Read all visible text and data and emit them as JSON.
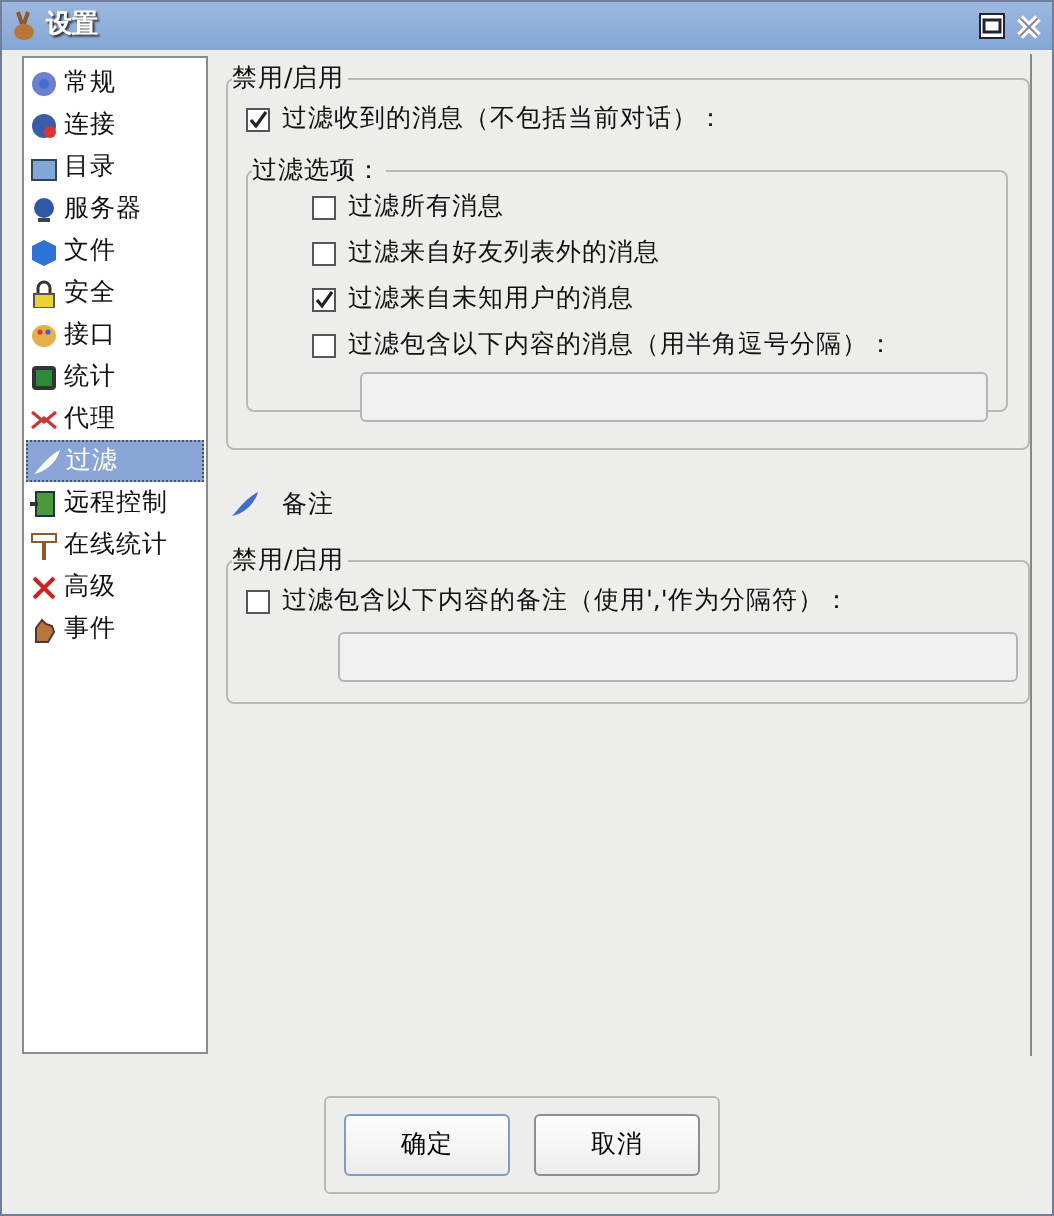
{
  "window": {
    "title": "设置"
  },
  "sidebar": {
    "items": [
      {
        "label": "常规",
        "selected": false
      },
      {
        "label": "连接",
        "selected": false
      },
      {
        "label": "目录",
        "selected": false
      },
      {
        "label": "服务器",
        "selected": false
      },
      {
        "label": "文件",
        "selected": false
      },
      {
        "label": "安全",
        "selected": false
      },
      {
        "label": "接口",
        "selected": false
      },
      {
        "label": "统计",
        "selected": false
      },
      {
        "label": "代理",
        "selected": false
      },
      {
        "label": "过滤",
        "selected": true
      },
      {
        "label": "远程控制",
        "selected": false
      },
      {
        "label": "在线统计",
        "selected": false
      },
      {
        "label": "高级",
        "selected": false
      },
      {
        "label": "事件",
        "selected": false
      }
    ]
  },
  "messages": {
    "group_title": "禁用/启用",
    "enable": {
      "label": "过滤收到的消息（不包括当前对话）：",
      "checked": true
    },
    "options_title": "过滤选项：",
    "options": [
      {
        "label": "过滤所有消息",
        "checked": false
      },
      {
        "label": "过滤来自好友列表外的消息",
        "checked": false
      },
      {
        "label": "过滤来自未知用户的消息",
        "checked": true
      },
      {
        "label": "过滤包含以下内容的消息（用半角逗号分隔）：",
        "checked": false
      }
    ]
  },
  "notes": {
    "heading": "备注",
    "group_title": "禁用/启用",
    "enable": {
      "label": "过滤包含以下内容的备注（使用','作为分隔符）：",
      "checked": false
    }
  },
  "buttons": [
    {
      "label": "确定",
      "default": true
    },
    {
      "label": "取消",
      "default": false
    }
  ]
}
